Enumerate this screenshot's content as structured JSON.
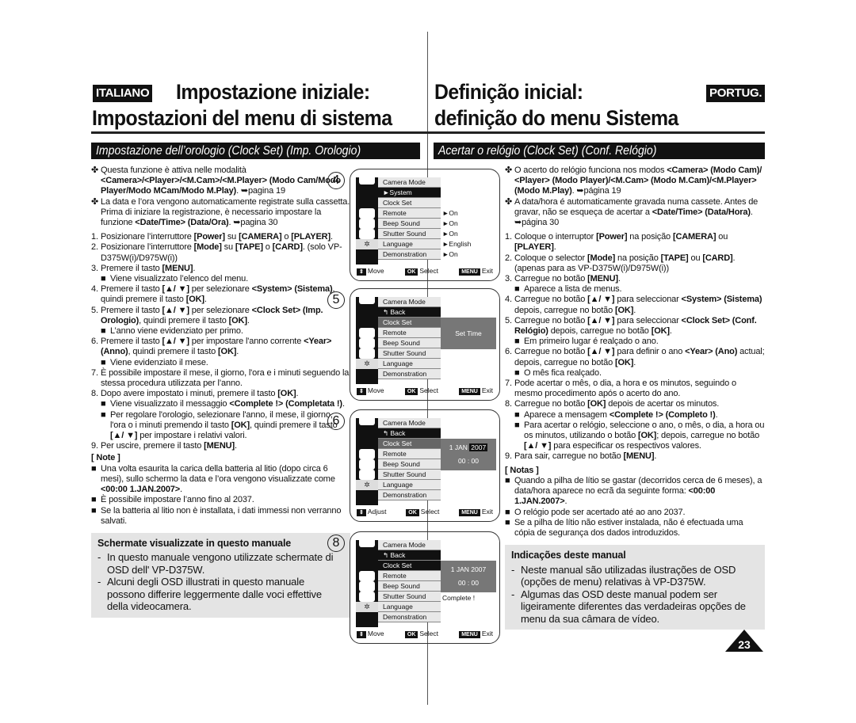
{
  "header": {
    "it_lang": "ITALIANO",
    "it_title1": "Impostazione iniziale:",
    "it_title2": "Impostazioni del menu di sistema",
    "pt_lang": "PORTUG.",
    "pt_title1": "Definição inicial:",
    "pt_title2": "definição do menu Sistema",
    "it_section": "Impostazione dell’orologio (Clock Set) (Imp. Orologio)",
    "pt_section": "Acertar o relógio (Clock Set) (Conf. Relógio)"
  },
  "italian": {
    "paras": [
      {
        "mk": "✤",
        "cls": "",
        "seg": [
          [
            "Questa funzione è attiva nelle modalità ",
            0
          ],
          [
            "<Camera>/<Player>/<M.Cam>/<M.Player> (Modo Cam/Modo Player/Modo MCam/Modo M.Play)",
            1
          ],
          [
            ". ➥pagina 19",
            0
          ]
        ]
      },
      {
        "mk": "✤",
        "cls": "",
        "seg": [
          [
            "La data e l’ora vengono automaticamente registrate sulla cassetta. Prima di iniziare la registrazione, è necessario impostare la funzione ",
            0
          ],
          [
            "<Date/Time> (Data/Ora)",
            1
          ],
          [
            ". ➥pagina 30",
            0
          ]
        ]
      },
      {
        "mk": "1.",
        "cls": "gapb",
        "seg": [
          [
            "Posizionare l’interruttore ",
            0
          ],
          [
            "[Power]",
            1
          ],
          [
            " su ",
            0
          ],
          [
            "[CAMERA]",
            1
          ],
          [
            " o ",
            0
          ],
          [
            "[PLAYER]",
            1
          ],
          [
            ".",
            0
          ]
        ]
      },
      {
        "mk": "2.",
        "cls": "",
        "seg": [
          [
            "Posizionare l’interruttore ",
            0
          ],
          [
            "[Mode]",
            1
          ],
          [
            " su ",
            0
          ],
          [
            "[TAPE]",
            1
          ],
          [
            " o ",
            0
          ],
          [
            "[CARD]",
            1
          ],
          [
            ". (solo VP-D375W(i)/D975W(i))",
            0
          ]
        ]
      },
      {
        "mk": "3.",
        "cls": "",
        "seg": [
          [
            "Premere il tasto ",
            0
          ],
          [
            "[MENU]",
            1
          ],
          [
            ".",
            0
          ]
        ]
      },
      {
        "mk": "■",
        "cls": "sub",
        "seg": [
          [
            "Viene visualizzato l’elenco del menu.",
            0
          ]
        ]
      },
      {
        "mk": "4.",
        "cls": "",
        "seg": [
          [
            "Premere il tasto ",
            0
          ],
          [
            "[▲/ ▼]",
            1
          ],
          [
            " per selezionare ",
            0
          ],
          [
            "<System> (Sistema)",
            1
          ],
          [
            ", quindi premere il tasto ",
            0
          ],
          [
            "[OK]",
            1
          ],
          [
            ".",
            0
          ]
        ]
      },
      {
        "mk": "5.",
        "cls": "",
        "seg": [
          [
            "Premere il tasto ",
            0
          ],
          [
            "[▲/ ▼]",
            1
          ],
          [
            " per selezionare ",
            0
          ],
          [
            "<Clock Set> (Imp. Orologio)",
            1
          ],
          [
            ", quindi premere il tasto ",
            0
          ],
          [
            "[OK]",
            1
          ],
          [
            ".",
            0
          ]
        ]
      },
      {
        "mk": "■",
        "cls": "sub",
        "seg": [
          [
            "L’anno viene evidenziato per primo.",
            0
          ]
        ]
      },
      {
        "mk": "6.",
        "cls": "",
        "seg": [
          [
            "Premere il tasto ",
            0
          ],
          [
            "[▲/ ▼]",
            1
          ],
          [
            " per impostare l'anno corrente ",
            0
          ],
          [
            "<Year> (Anno)",
            1
          ],
          [
            ", quindi premere il tasto ",
            0
          ],
          [
            "[OK]",
            1
          ],
          [
            ".",
            0
          ]
        ]
      },
      {
        "mk": "■",
        "cls": "sub",
        "seg": [
          [
            "Viene evidenziato il mese.",
            0
          ]
        ]
      },
      {
        "mk": "7.",
        "cls": "",
        "seg": [
          [
            "È possibile impostare il mese, il giorno, l'ora e i minuti seguendo la stessa procedura utilizzata per l’anno.",
            0
          ]
        ]
      },
      {
        "mk": "8.",
        "cls": "",
        "seg": [
          [
            "Dopo avere impostato i minuti, premere il tasto ",
            0
          ],
          [
            "[OK]",
            1
          ],
          [
            ".",
            0
          ]
        ]
      },
      {
        "mk": "■",
        "cls": "sub",
        "seg": [
          [
            "Viene visualizzato il messaggio ",
            0
          ],
          [
            "<Complete !> (Completata !)",
            1
          ],
          [
            ".",
            0
          ]
        ]
      },
      {
        "mk": "■",
        "cls": "sub",
        "seg": [
          [
            "Per regolare l'orologio, selezionare l'anno, il mese, il giorno, l'ora o i minuti premendo il tasto ",
            0
          ],
          [
            "[OK]",
            1
          ],
          [
            ", quindi premere il tasto ",
            0
          ],
          [
            "[▲/ ▼]",
            1
          ],
          [
            " per impostare i relativi valori.",
            0
          ]
        ]
      },
      {
        "mk": "9.",
        "cls": "",
        "seg": [
          [
            "Per uscire, premere il tasto ",
            0
          ],
          [
            "[MENU]",
            1
          ],
          [
            ".",
            0
          ]
        ]
      }
    ],
    "note_title": "[ Note ]",
    "notes": [
      {
        "mk": "■",
        "cls": "note",
        "seg": [
          [
            "Una volta esaurita la carica della batteria al litio (dopo circa 6 mesi), sullo schermo la data e l’ora vengono visualizzate come ",
            0
          ],
          [
            "<00:00  1.JAN.2007>",
            1
          ],
          [
            ".",
            0
          ]
        ]
      },
      {
        "mk": "■",
        "cls": "note",
        "seg": [
          [
            "È possibile impostare l’anno fino al 2037.",
            0
          ]
        ]
      },
      {
        "mk": "■",
        "cls": "note",
        "seg": [
          [
            "Se la batteria al litio non è installata, i dati immessi non verranno salvati.",
            0
          ]
        ]
      }
    ],
    "box_title": "Schermate visualizzate in questo manuale",
    "box_items": [
      "In questo manuale vengono utilizzate schermate di OSD dell' VP-D375W.",
      "Alcuni degli OSD illustrati in questo manuale possono differire leggermente dalle voci effettive della videocamera."
    ]
  },
  "portuguese": {
    "paras": [
      {
        "mk": "✤",
        "cls": "",
        "seg": [
          [
            "O acerto do relógio funciona nos modos ",
            0
          ],
          [
            "<Camera> (Modo Cam)/ <Player> (Modo Player)/<M.Cam> (Modo M.Cam)/<M.Player> (Modo M.Play)",
            1
          ],
          [
            ". ➥página 19",
            0
          ]
        ]
      },
      {
        "mk": "✤",
        "cls": "",
        "seg": [
          [
            "A data/hora é automaticamente gravada numa cassete. Antes de gravar, não se esqueça de acertar a ",
            0
          ],
          [
            "<Date/Time> (Data/Hora)",
            1
          ],
          [
            ". ➥página 30",
            0
          ]
        ]
      },
      {
        "mk": "1.",
        "cls": "gapb",
        "seg": [
          [
            "Coloque o interruptor ",
            0
          ],
          [
            "[Power]",
            1
          ],
          [
            " na posição ",
            0
          ],
          [
            "[CAMERA]",
            1
          ],
          [
            " ou ",
            0
          ],
          [
            "[PLAYER]",
            1
          ],
          [
            ".",
            0
          ]
        ]
      },
      {
        "mk": "2.",
        "cls": "",
        "seg": [
          [
            "Coloque o selector ",
            0
          ],
          [
            "[Mode]",
            1
          ],
          [
            " na posição ",
            0
          ],
          [
            "[TAPE]",
            1
          ],
          [
            " ou ",
            0
          ],
          [
            "[CARD]",
            1
          ],
          [
            ". (apenas para as VP-D375W(i)/D975W(i))",
            0
          ]
        ]
      },
      {
        "mk": "3.",
        "cls": "",
        "seg": [
          [
            "Carregue no botão ",
            0
          ],
          [
            "[MENU]",
            1
          ],
          [
            ".",
            0
          ]
        ]
      },
      {
        "mk": "■",
        "cls": "sub",
        "seg": [
          [
            "Aparece a lista de menus.",
            0
          ]
        ]
      },
      {
        "mk": "4.",
        "cls": "",
        "seg": [
          [
            "Carregue no botão ",
            0
          ],
          [
            "[▲/ ▼]",
            1
          ],
          [
            " para seleccionar ",
            0
          ],
          [
            "<System> (Sistema)",
            1
          ],
          [
            " depois, carregue no botão ",
            0
          ],
          [
            "[OK]",
            1
          ],
          [
            ".",
            0
          ]
        ]
      },
      {
        "mk": "5.",
        "cls": "",
        "seg": [
          [
            "Carregue no botão ",
            0
          ],
          [
            "[▲/ ▼]",
            1
          ],
          [
            " para seleccionar ",
            0
          ],
          [
            "<Clock Set> (Conf. Relógio)",
            1
          ],
          [
            " depois, carregue no botão ",
            0
          ],
          [
            "[OK]",
            1
          ],
          [
            ".",
            0
          ]
        ]
      },
      {
        "mk": "■",
        "cls": "sub",
        "seg": [
          [
            "Em primeiro lugar é realçado o ano.",
            0
          ]
        ]
      },
      {
        "mk": "6.",
        "cls": "",
        "seg": [
          [
            "Carregue no botão ",
            0
          ],
          [
            "[▲/ ▼]",
            1
          ],
          [
            " para definir o ano ",
            0
          ],
          [
            "<Year> (Ano)",
            1
          ],
          [
            " actual; depois, carregue no botão ",
            0
          ],
          [
            "[OK]",
            1
          ],
          [
            ".",
            0
          ]
        ]
      },
      {
        "mk": "■",
        "cls": "sub",
        "seg": [
          [
            "O mês fica realçado.",
            0
          ]
        ]
      },
      {
        "mk": "7.",
        "cls": "",
        "seg": [
          [
            "Pode acertar o mês, o dia, a hora e os minutos, seguindo o mesmo procedimento após o acerto do ano.",
            0
          ]
        ]
      },
      {
        "mk": "8.",
        "cls": "",
        "seg": [
          [
            "Carregue no botão ",
            0
          ],
          [
            "[OK]",
            1
          ],
          [
            " depois de acertar os minutos.",
            0
          ]
        ]
      },
      {
        "mk": "■",
        "cls": "sub",
        "seg": [
          [
            "Aparece a mensagem ",
            0
          ],
          [
            "<Complete !> (Completo !)",
            1
          ],
          [
            ".",
            0
          ]
        ]
      },
      {
        "mk": "■",
        "cls": "sub",
        "seg": [
          [
            "Para acertar o relógio, seleccione o ano, o mês, o dia, a hora ou os minutos, utilizando o botão ",
            0
          ],
          [
            "[OK]",
            1
          ],
          [
            "; depois, carregue no botão ",
            0
          ],
          [
            "[▲/ ▼]",
            1
          ],
          [
            " para especificar os respectivos valores.",
            0
          ]
        ]
      },
      {
        "mk": "9.",
        "cls": "",
        "seg": [
          [
            "Para sair, carregue no botão ",
            0
          ],
          [
            "[MENU]",
            1
          ],
          [
            ".",
            0
          ]
        ]
      }
    ],
    "note_title": "[ Notas ]",
    "notes": [
      {
        "mk": "■",
        "cls": "note",
        "seg": [
          [
            "Quando a pilha de lítio se gastar (decorridos cerca de 6 meses), a data/hora aparece no ecrã da seguinte forma: ",
            0
          ],
          [
            "<00:00  1.JAN.2007>",
            1
          ],
          [
            ".",
            0
          ]
        ]
      },
      {
        "mk": "■",
        "cls": "note",
        "seg": [
          [
            "O relógio pode ser acertado até ao ano 2037.",
            0
          ]
        ]
      },
      {
        "mk": "■",
        "cls": "note",
        "seg": [
          [
            "Se a pilha de lítio não estiver instalada, não é efectuada uma cópia de segurança dos dados introduzidos.",
            0
          ]
        ]
      }
    ],
    "box_title": "Indicações deste manual",
    "box_items": [
      "Neste manual são utilizadas ilustrações de OSD (opções de menu) relativas à VP-D375W.",
      "Algumas das OSD deste manual podem ser ligeiramente diferentes das verdadeiras opções de menu da sua câmara de vídeo."
    ]
  },
  "screens": [
    {
      "step": "4",
      "header": "Camera Mode",
      "rows": [
        [
          "►System",
          "black",
          ""
        ],
        [
          "Clock Set",
          "",
          ""
        ],
        [
          "Remote",
          "",
          "►On"
        ],
        [
          "Beep Sound",
          "",
          "►On"
        ],
        [
          "Shutter Sound",
          "",
          "►On"
        ],
        [
          "Language",
          "",
          "►English"
        ],
        [
          "Demonstration",
          "",
          "►On"
        ]
      ],
      "panel": null,
      "message": "",
      "footer": [
        [
          "⇕",
          "Move"
        ],
        [
          "OK",
          "Select"
        ],
        [
          "MENU",
          "Exit"
        ]
      ]
    },
    {
      "step": "5",
      "header": "Camera Mode",
      "rows": [
        [
          "↰ Back",
          "black",
          ""
        ],
        [
          "Clock Set",
          "gray",
          ""
        ],
        [
          "Remote",
          "",
          ""
        ],
        [
          "Beep Sound",
          "",
          ""
        ],
        [
          "Shutter Sound",
          "",
          ""
        ],
        [
          "Language",
          "",
          ""
        ],
        [
          "Demonstration",
          "",
          ""
        ]
      ],
      "panel": {
        "line1": "Set Time",
        "date": "",
        "year": "",
        "time": ""
      },
      "message": "",
      "footer": [
        [
          "⇕",
          "Move"
        ],
        [
          "OK",
          "Select"
        ],
        [
          "MENU",
          "Exit"
        ]
      ]
    },
    {
      "step": "6",
      "header": "Camera Mode",
      "rows": [
        [
          "↰ Back",
          "black",
          ""
        ],
        [
          "Clock Set",
          "gray",
          ""
        ],
        [
          "Remote",
          "",
          ""
        ],
        [
          "Beep Sound",
          "",
          ""
        ],
        [
          "Shutter Sound",
          "",
          ""
        ],
        [
          "Language",
          "",
          ""
        ],
        [
          "Demonstration",
          "",
          ""
        ]
      ],
      "panel": {
        "line1": "",
        "date": "1  JAN",
        "year": "2007",
        "year_highlight": true,
        "time": "00 : 00"
      },
      "message": "",
      "footer": [
        [
          "⇕",
          "Adjust"
        ],
        [
          "OK",
          "Select"
        ],
        [
          "MENU",
          "Exit"
        ]
      ]
    },
    {
      "step": "8",
      "header": "Camera Mode",
      "rows": [
        [
          "↰ Back",
          "black",
          ""
        ],
        [
          "Clock Set",
          "black",
          ""
        ],
        [
          "Remote",
          "",
          ""
        ],
        [
          "Beep Sound",
          "",
          ""
        ],
        [
          "Shutter Sound",
          "",
          ""
        ],
        [
          "Language",
          "",
          ""
        ],
        [
          "Demonstration",
          "",
          ""
        ]
      ],
      "panel": {
        "line1": "",
        "date": "1  JAN",
        "year": "2007",
        "time": "00 : 00"
      },
      "message": "Complete !",
      "footer": [
        [
          "⇕",
          "Move"
        ],
        [
          "OK",
          "Select"
        ],
        [
          "MENU",
          "Exit"
        ]
      ]
    }
  ],
  "page_number": "23"
}
